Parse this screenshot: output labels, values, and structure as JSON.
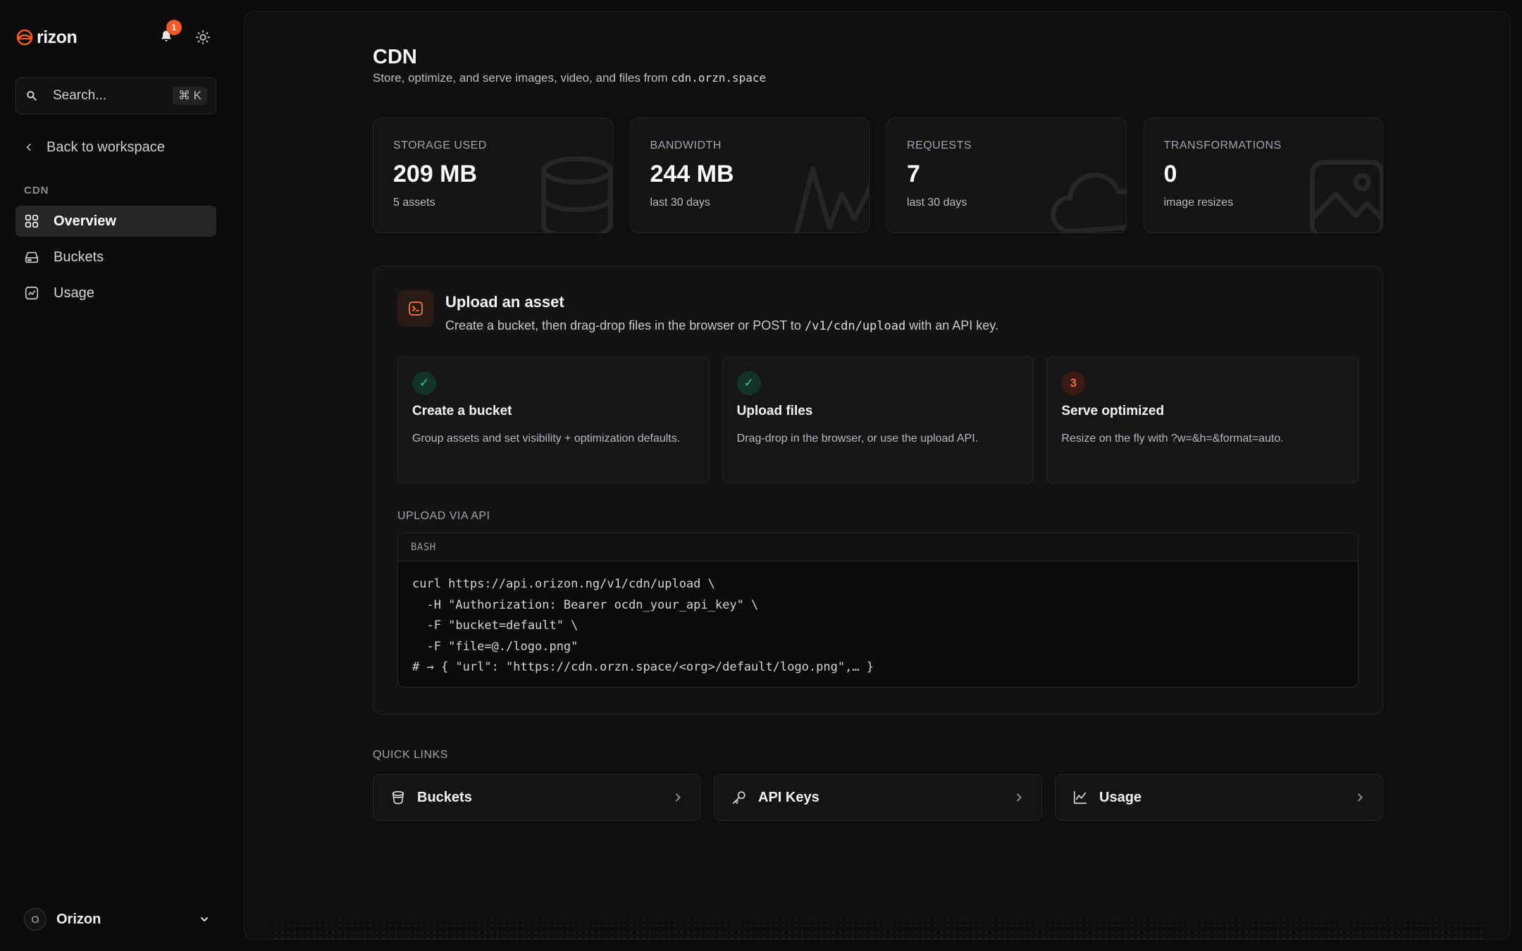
{
  "brand": {
    "name": "rizon",
    "accent": "#f05a24"
  },
  "header": {
    "notification_count": "1"
  },
  "search": {
    "placeholder": "Search...",
    "shortcut": "⌘ K"
  },
  "sidebar": {
    "back_label": "Back to workspace",
    "section_label": "CDN",
    "items": [
      {
        "label": "Overview",
        "icon": "grid-icon",
        "active": true
      },
      {
        "label": "Buckets",
        "icon": "drive-icon",
        "active": false
      },
      {
        "label": "Usage",
        "icon": "chart-icon",
        "active": false
      }
    ],
    "org": {
      "initial": "O",
      "name": "Orizon"
    }
  },
  "page": {
    "title": "CDN",
    "subtitle_prefix": "Store, optimize, and serve images, video, and files from ",
    "subtitle_domain": "cdn.orzn.space"
  },
  "stats": [
    {
      "label": "STORAGE USED",
      "value": "209 MB",
      "sub": "5 assets"
    },
    {
      "label": "BANDWIDTH",
      "value": "244 MB",
      "sub": "last 30 days"
    },
    {
      "label": "REQUESTS",
      "value": "7",
      "sub": "last 30 days"
    },
    {
      "label": "TRANSFORMATIONS",
      "value": "0",
      "sub": "image resizes"
    }
  ],
  "upload": {
    "title": "Upload an asset",
    "desc_prefix": "Create a bucket, then drag-drop files in the browser or POST to ",
    "desc_endpoint": "/v1/cdn/upload",
    "desc_suffix": " with an API key.",
    "steps": [
      {
        "badge": "✓",
        "status": "done",
        "title": "Create a bucket",
        "desc": "Group assets and set visibility + optimization defaults."
      },
      {
        "badge": "✓",
        "status": "done",
        "title": "Upload files",
        "desc": "Drag-drop in the browser, or use the upload API."
      },
      {
        "badge": "3",
        "status": "todo",
        "title": "Serve optimized",
        "desc": "Resize on the fly with ?w=&h=&format=auto."
      }
    ],
    "api_label": "UPLOAD VIA API",
    "code_lang": "BASH",
    "code": "curl https://api.orizon.ng/v1/cdn/upload \\\n  -H \"Authorization: Bearer ocdn_your_api_key\" \\\n  -F \"bucket=default\" \\\n  -F \"file=@./logo.png\"\n# → { \"url\": \"https://cdn.orzn.space/<org>/default/logo.png\",… }"
  },
  "quick_links": {
    "label": "QUICK LINKS",
    "items": [
      {
        "label": "Buckets",
        "icon": "bucket-icon"
      },
      {
        "label": "API Keys",
        "icon": "key-icon"
      },
      {
        "label": "Usage",
        "icon": "line-chart-icon"
      }
    ]
  }
}
